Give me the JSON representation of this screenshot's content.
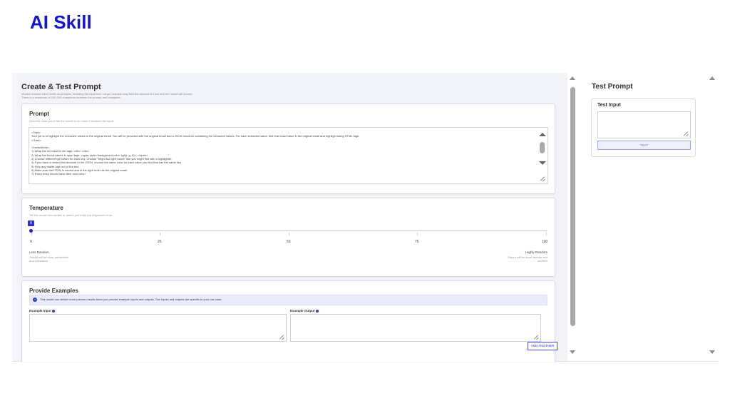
{
  "slide_title": "AI Skill",
  "left_pane": {
    "title": "Create & Test Prompt",
    "subtitle_line1": "Models enforce token limits on prompts, including the input text. Larger prompts may limit the amount of input text the model will accept.",
    "subtitle_line2": "There is a maximum of 150,000 characters between the prompt and examples."
  },
  "prompt_card": {
    "title": "Prompt",
    "description": "Describe what you'd like the model to do when it receives the input.",
    "lines": [
      "<Task>",
      "Your job is to highlight the extracted values in the original email. You will be provided with the original email and a JSON structure containing the extracted values. For each extracted value, find that exact value in the original email and highlight using HTML tags.",
      "</Task>",
      "",
      "<Instructions>",
      "1) Wrap the full result in div tags: <div> </div>",
      "2) Wrap the found values in span tags: <span style='background-color: rgb(r, g, b)'> </span>.",
      "3) Choose different rgb colors for each key. Choose \"bright but light colors\" like you might find with a highlighter.",
      "4) If you have a nested list structure in the JSON, choose the same color for each value you find that has the same key.",
      "5) Strip any mailto tags out of the text.",
      "6) Make sure the HTML is correct and in the right order as the original email.",
      "7) Every entry should have their own color!"
    ]
  },
  "temperature_card": {
    "title": "Temperature",
    "description": "Tell the model how similar or varied you'd like the responses to be.",
    "value": "0",
    "value_fraction": 0,
    "ticks": [
      "0",
      "25",
      "50",
      "75",
      "100"
    ],
    "left_label": "Less Random",
    "left_desc_1": "Output will be more predictable",
    "left_desc_2": "and consistent",
    "right_label": "Highly Random",
    "right_desc_1": "Output will be more diverse and",
    "right_desc_2": "creative"
  },
  "examples_card": {
    "title": "Provide Examples",
    "info": "This model can deliver more precise results when you provide example inputs and outputs. The inputs and outputs are specific to your use case.",
    "input_label": "Example Input",
    "output_label": "Example Output",
    "add_button": "ADD ANOTHER"
  },
  "right_pane": {
    "title": "Test Prompt",
    "card_title": "Test Input",
    "test_button": "TEST"
  },
  "colors": {
    "slide_title": "#1515d6",
    "accent": "#2f2fd8",
    "pane_background": "#f3f3fa"
  }
}
